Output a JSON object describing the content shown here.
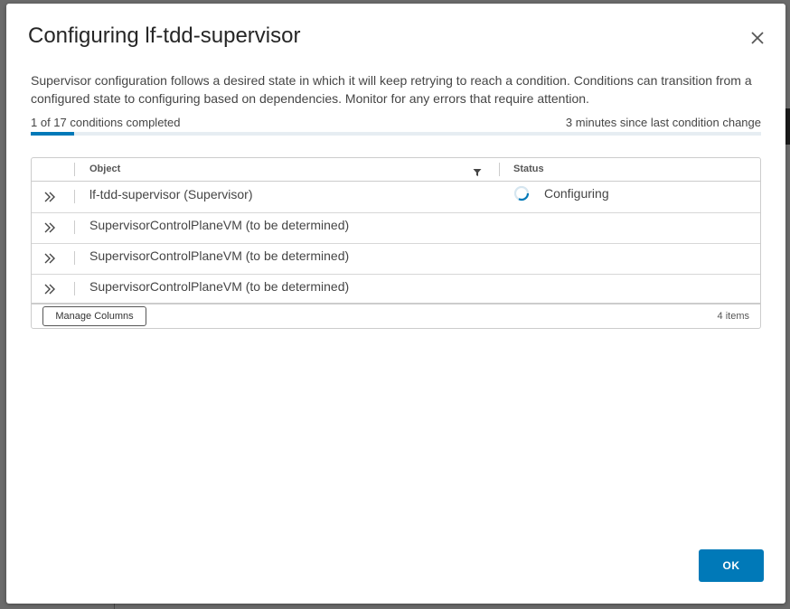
{
  "modal": {
    "title": "Configuring lf-tdd-supervisor",
    "description": "Supervisor configuration follows a desired state in which it will keep retrying to reach a condition. Conditions can transition from a configured state to configuring based on dependencies. Monitor for any errors that require attention.",
    "close_icon": "close-icon"
  },
  "progress": {
    "completed_label": "1 of 17 conditions completed",
    "last_change_label": "3 minutes since last condition change",
    "completed": 1,
    "total": 17,
    "fraction": 0.0588,
    "fill_color": "#0079b8",
    "track_color": "#e6edf2"
  },
  "grid": {
    "columns": [
      "Object",
      "Status"
    ],
    "filter_icon": "filter-icon",
    "expand_icon": "double-chevron-right-icon",
    "rows": [
      {
        "object": "lf-tdd-supervisor (Supervisor)",
        "status": "Configuring",
        "status_icon": "spinner-icon"
      },
      {
        "object": "SupervisorControlPlaneVM (to be determined)",
        "status": ""
      },
      {
        "object": "SupervisorControlPlaneVM (to be determined)",
        "status": ""
      },
      {
        "object": "SupervisorControlPlaneVM (to be determined)",
        "status": ""
      }
    ],
    "manage_columns_label": "Manage Columns",
    "items_count": "4 items"
  },
  "footer": {
    "ok_label": "OK",
    "ok_color": "#0079b8"
  }
}
